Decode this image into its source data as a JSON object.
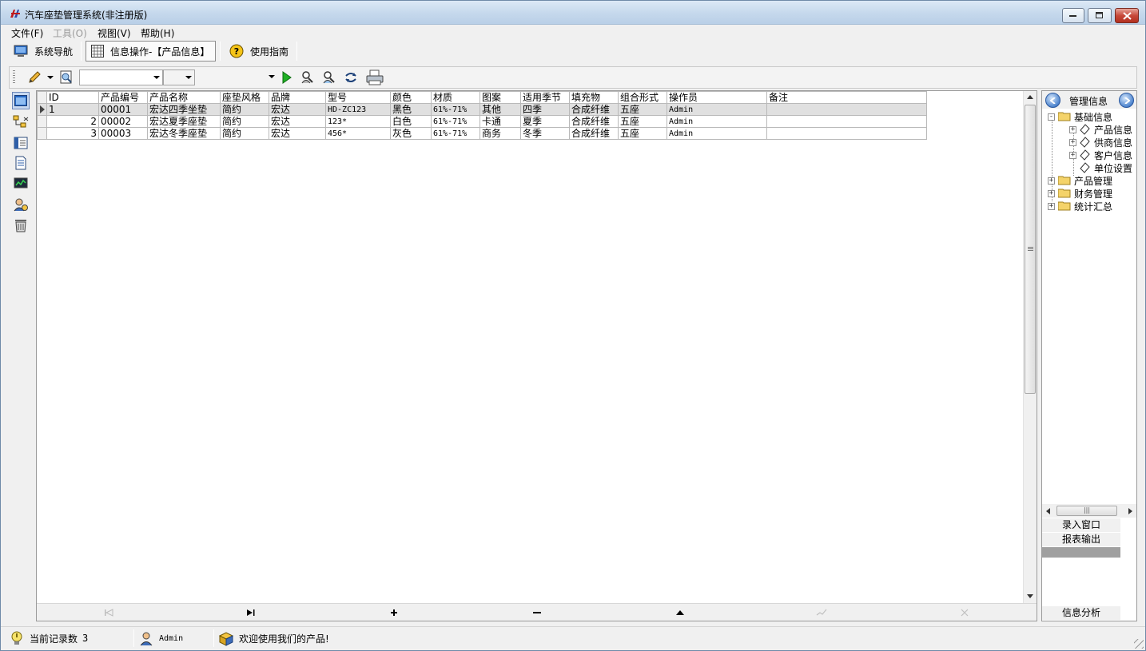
{
  "window": {
    "title": "汽车座垫管理系统(非注册版)"
  },
  "menu": [
    {
      "label": "文件(F)",
      "enabled": true
    },
    {
      "label": "工具(O)",
      "enabled": false
    },
    {
      "label": "视图(V)",
      "enabled": true
    },
    {
      "label": "帮助(H)",
      "enabled": true
    }
  ],
  "nav": {
    "system_nav": "系统导航",
    "info_op": "信息操作-【产品信息】",
    "guide": "使用指南"
  },
  "grid": {
    "columns": [
      "ID",
      "产品编号",
      "产品名称",
      "座垫风格",
      "品牌",
      "型号",
      "颜色",
      "材质",
      "图案",
      "适用季节",
      "填充物",
      "组合形式",
      "操作员",
      "备注"
    ],
    "rows": [
      [
        "1",
        "00001",
        "宏达四季坐垫",
        "简约",
        "宏达",
        "HD-ZC123",
        "黑色",
        "61%-71%",
        "其他",
        "四季",
        "合成纤维",
        "五座",
        "Admin",
        ""
      ],
      [
        "2",
        "00002",
        "宏达夏季座垫",
        "简约",
        "宏达",
        "123*",
        "白色",
        "61%-71%",
        "卡通",
        "夏季",
        "合成纤维",
        "五座",
        "Admin",
        ""
      ],
      [
        "3",
        "00003",
        "宏达冬季座垫",
        "简约",
        "宏达",
        "456*",
        "灰色",
        "61%-71%",
        "商务",
        "冬季",
        "合成纤维",
        "五座",
        "Admin",
        ""
      ]
    ],
    "current_row": 0
  },
  "right_panel": {
    "title": "管理信息",
    "tree": {
      "root": "基础信息",
      "children": [
        "产品信息",
        "供商信息",
        "客户信息",
        "单位设置"
      ],
      "others": [
        "产品管理",
        "财务管理",
        "统计汇总"
      ]
    },
    "buttons": [
      "录入窗口",
      "报表输出"
    ],
    "bottom_button": "信息分析"
  },
  "status": {
    "record_label": "当前记录数",
    "record_count": "3",
    "user": "Admin",
    "welcome": "欢迎使用我们的产品!"
  },
  "icons": {
    "app": "app-logo-icon",
    "system_nav": "monitor-icon",
    "info_op": "grid-icon",
    "guide": "help-icon"
  }
}
